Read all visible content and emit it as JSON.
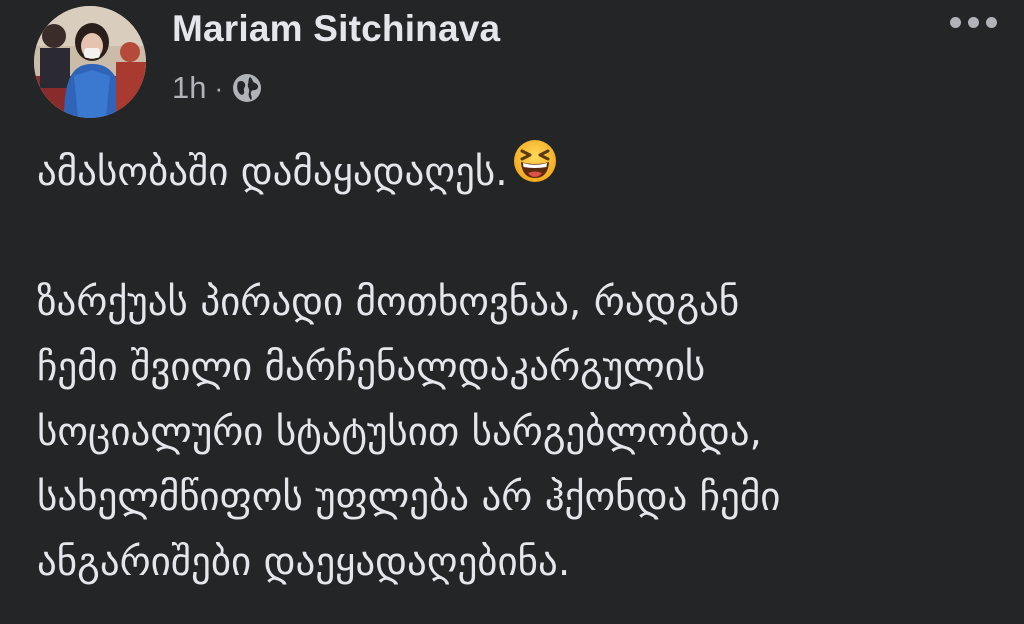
{
  "post": {
    "author": "Mariam Sitchinava",
    "time": "1h",
    "separator": "·",
    "audience_icon": "globe-icon",
    "more_icon": "more-options-icon",
    "lines": [
      "ამასობაში დამაყადაღეს.",
      "ზარქუას პირადი მოთხოვნაა, რადგან",
      "ჩემი შვილი მარჩენალდაკარგულის",
      "სოციალური სტატუსით სარგებლობდა,",
      "სახელმწიფოს უფლება არ ჰქონდა ჩემი",
      "ანგარიშები დაეყადაღებინა."
    ],
    "emoji": "laughing-face-emoji"
  },
  "colors": {
    "background": "#242526",
    "primary_text": "#e4e6eb",
    "secondary_text": "#b0b3b8"
  }
}
